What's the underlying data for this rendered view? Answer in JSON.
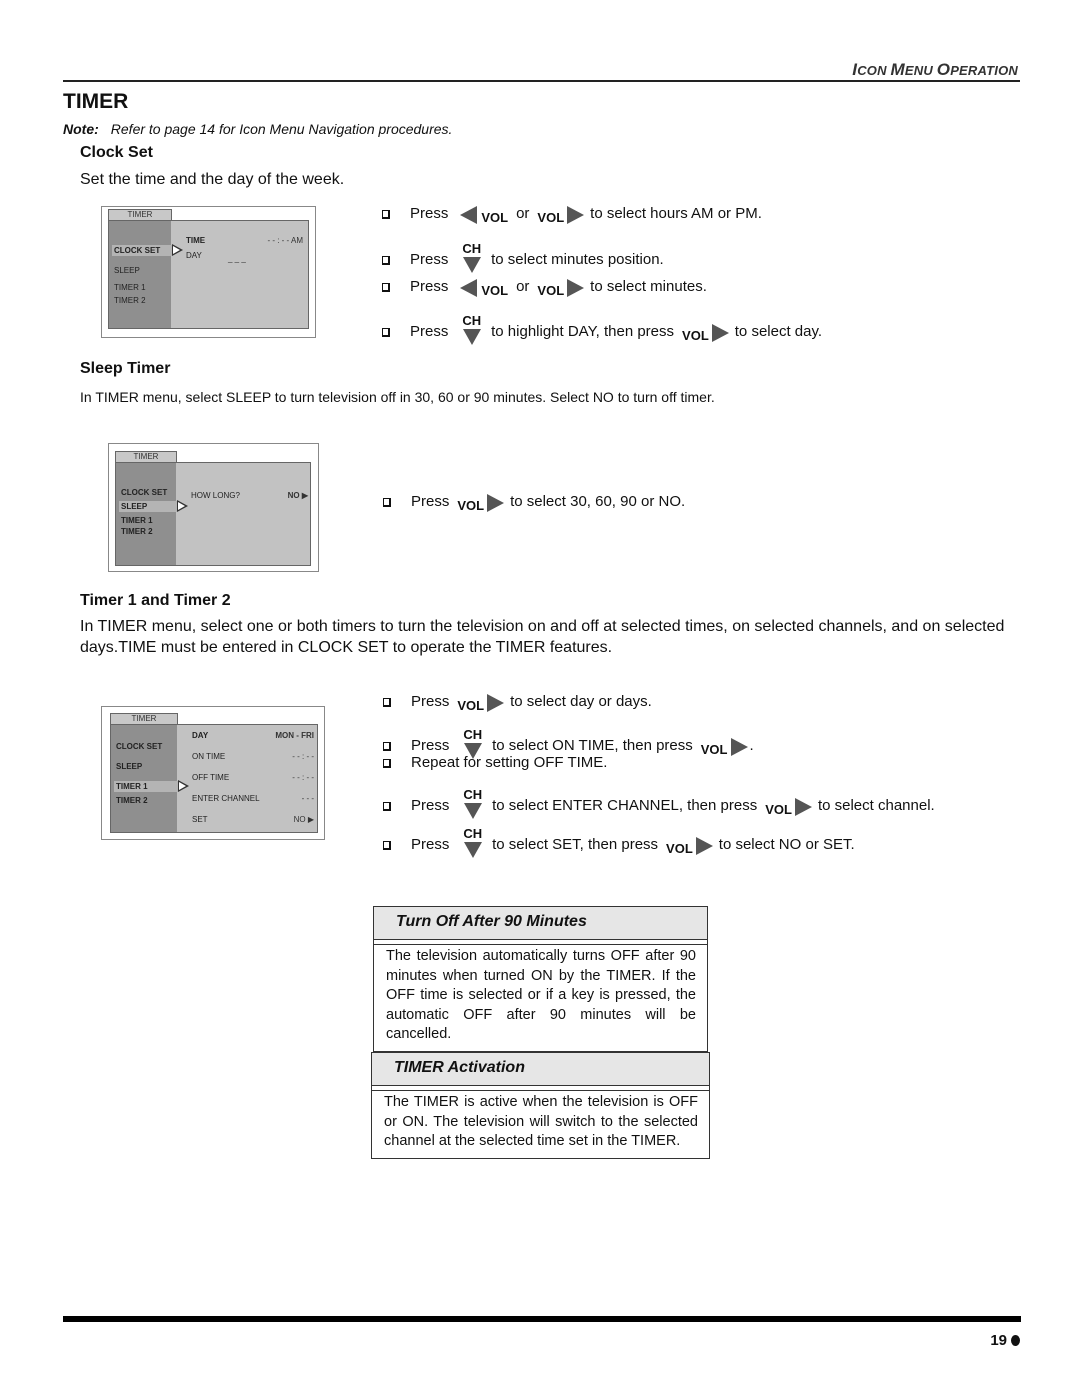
{
  "header": {
    "section_label": "ICON MENU OPERATION",
    "section_label_parts": [
      [
        "I",
        "CON "
      ],
      [
        "M",
        "ENU "
      ],
      [
        "O",
        "PERATION"
      ]
    ]
  },
  "page_title": "TIMER",
  "note": {
    "label": "Note:",
    "text": "Refer to page 14 for Icon Menu Navigation procedures."
  },
  "clock_set": {
    "heading": "Clock Set",
    "intro": "Set the time and the day of the week.",
    "osd": {
      "tab": "TIMER",
      "menu_items": [
        "CLOCK SET",
        "SLEEP",
        "TIMER 1",
        "TIMER 2"
      ],
      "selected": "CLOCK SET",
      "fields": [
        {
          "label": "TIME",
          "value": "- - : - -  AM"
        },
        {
          "label": "DAY",
          "value": "_ _ _"
        }
      ]
    },
    "steps": [
      {
        "parts": [
          {
            "t": "text",
            "v": "Press"
          },
          {
            "t": "vol-left",
            "v": "VOL"
          },
          {
            "t": "text",
            "v": "or"
          },
          {
            "t": "vol-right",
            "v": "VOL"
          },
          {
            "t": "text",
            "v": "to select hours AM or PM."
          }
        ]
      },
      {
        "parts": [
          {
            "t": "text",
            "v": "Press"
          },
          {
            "t": "ch-down",
            "v": "CH"
          },
          {
            "t": "text",
            "v": "to select minutes position."
          }
        ]
      },
      {
        "parts": [
          {
            "t": "text",
            "v": "Press"
          },
          {
            "t": "vol-left",
            "v": "VOL"
          },
          {
            "t": "text",
            "v": "or"
          },
          {
            "t": "vol-right",
            "v": "VOL"
          },
          {
            "t": "text",
            "v": "to select minutes."
          }
        ]
      },
      {
        "parts": [
          {
            "t": "text",
            "v": "Press"
          },
          {
            "t": "ch-down",
            "v": "CH"
          },
          {
            "t": "text",
            "v": "to highlight DAY, then press"
          },
          {
            "t": "vol-right",
            "v": "VOL"
          },
          {
            "t": "text",
            "v": "to select day."
          }
        ]
      }
    ]
  },
  "sleep_timer": {
    "heading": "Sleep Timer",
    "intro": "In TIMER menu, select SLEEP to turn television off in 30, 60 or 90 minutes. Select NO to turn off timer.",
    "osd": {
      "tab": "TIMER",
      "menu_items": [
        "CLOCK SET",
        "SLEEP",
        "TIMER 1",
        "TIMER 2"
      ],
      "selected": "SLEEP",
      "fields": [
        {
          "label": "HOW LONG?",
          "value": "NO ▶"
        }
      ]
    },
    "steps": [
      {
        "parts": [
          {
            "t": "text",
            "v": "Press"
          },
          {
            "t": "vol-right",
            "v": "VOL"
          },
          {
            "t": "text",
            "v": "to select 30, 60, 90 or NO."
          }
        ]
      }
    ]
  },
  "timer12": {
    "heading": "Timer 1 and Timer 2",
    "intro": "In TIMER menu, select one or both timers to turn the television on and off at selected times, on selected channels, and on selected days.TIME must be entered in CLOCK SET to operate the TIMER features.",
    "osd": {
      "tab": "TIMER",
      "menu_items": [
        "CLOCK SET",
        "SLEEP",
        "TIMER 1",
        "TIMER 2"
      ],
      "selected": "TIMER 1",
      "fields": [
        {
          "label": "DAY",
          "value": "MON - FRI"
        },
        {
          "label": "ON TIME",
          "value": "- -  :  - -"
        },
        {
          "label": "OFF TIME",
          "value": "- -  :  - -"
        },
        {
          "label": "ENTER CHANNEL",
          "value": "-  -  -"
        },
        {
          "label": "SET",
          "value": "NO ▶"
        }
      ]
    },
    "steps": [
      {
        "parts": [
          {
            "t": "text",
            "v": "Press"
          },
          {
            "t": "vol-right",
            "v": "VOL"
          },
          {
            "t": "text",
            "v": "to select day or days."
          }
        ]
      },
      {
        "parts": [
          {
            "t": "text",
            "v": "Press"
          },
          {
            "t": "ch-down",
            "v": "CH"
          },
          {
            "t": "text",
            "v": "to select ON TIME, then press"
          },
          {
            "t": "vol-right",
            "v": "VOL"
          },
          {
            "t": "text",
            "v": "."
          }
        ]
      },
      {
        "parts": [
          {
            "t": "text",
            "v": "Repeat for setting OFF TIME."
          }
        ]
      },
      {
        "parts": [
          {
            "t": "text",
            "v": "Press"
          },
          {
            "t": "ch-down",
            "v": "CH"
          },
          {
            "t": "text",
            "v": "to select ENTER CHANNEL, then press"
          },
          {
            "t": "vol-right",
            "v": "VOL"
          },
          {
            "t": "text",
            "v": "to select channel."
          }
        ]
      },
      {
        "parts": [
          {
            "t": "text",
            "v": "Press"
          },
          {
            "t": "ch-down",
            "v": "CH"
          },
          {
            "t": "text",
            "v": "to select SET, then press"
          },
          {
            "t": "vol-right",
            "v": "VOL"
          },
          {
            "t": "text",
            "v": "to select NO or SET."
          }
        ]
      }
    ]
  },
  "info_boxes": [
    {
      "title": "Turn Off After 90 Minutes",
      "body": "The television automatically turns OFF after 90 minutes when turned ON by the TIMER. If the OFF time is selected or if a key is pressed, the automatic OFF after 90 minutes will be cancelled."
    },
    {
      "title": "TIMER Activation",
      "body": "The TIMER is active when the television is OFF or ON. The television will switch to the selected channel at the selected time set in the TIMER."
    }
  ],
  "footer": {
    "page_number": "19"
  }
}
